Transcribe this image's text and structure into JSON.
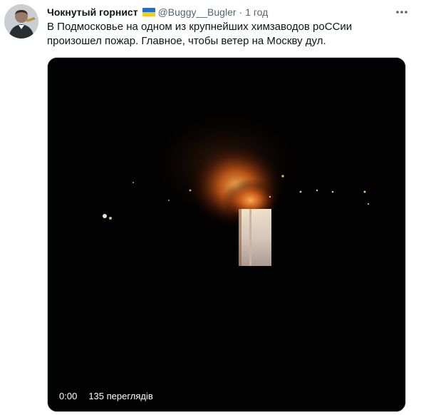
{
  "tweet": {
    "display_name": "Чокнутый горнист",
    "handle": "@Buggy__Bugler",
    "separator": "·",
    "time": "1 год",
    "text": "В Подмосковье на одном из крупнейших химзаводов  роССии произошел пожар. Главное, чтобы ветер на Москву дул.",
    "more_icon": "more-dots-icon"
  },
  "video": {
    "current_time": "0:00",
    "views": "135 переглядів",
    "frame_description_icon": "fire-video-frame"
  },
  "colors": {
    "text": "#0f1419",
    "secondary": "#536471",
    "flag_blue": "#1c6fd6",
    "flag_yellow": "#f5cc1d"
  }
}
